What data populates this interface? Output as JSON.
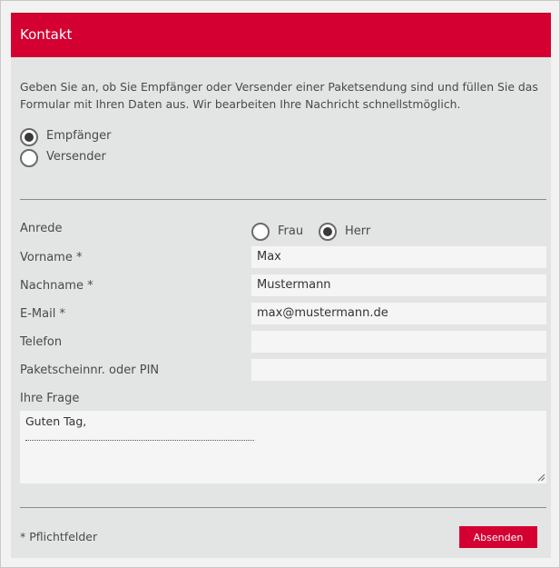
{
  "header": {
    "title": "Kontakt"
  },
  "intro": {
    "text": "Geben Sie an, ob Sie Empfänger oder Versender einer Paketsendung sind und füllen Sie das Formular mit Ihren Daten aus. Wir bearbeiten Ihre Nachricht schnellstmöglich."
  },
  "role": {
    "options": [
      {
        "label": "Empfänger",
        "checked": true
      },
      {
        "label": "Versender",
        "checked": false
      }
    ]
  },
  "form": {
    "salutation": {
      "label": "Anrede",
      "options": [
        {
          "label": "Frau",
          "checked": false
        },
        {
          "label": "Herr",
          "checked": true
        }
      ]
    },
    "first_name": {
      "label": "Vorname *",
      "value": "Max"
    },
    "last_name": {
      "label": "Nachname *",
      "value": "Mustermann"
    },
    "email": {
      "label": "E-Mail *",
      "value": "max@mustermann.de"
    },
    "phone": {
      "label": "Telefon",
      "value": ""
    },
    "tracking": {
      "label": "Paketscheinnr. oder PIN",
      "value": ""
    },
    "question": {
      "label": "Ihre Frage",
      "value": "Guten Tag,"
    }
  },
  "footer": {
    "required_note": "* Pflichtfelder",
    "submit_label": "Absenden"
  },
  "colors": {
    "brand": "#d40032",
    "panel": "#e3e4e4",
    "input": "#f5f5f5"
  }
}
